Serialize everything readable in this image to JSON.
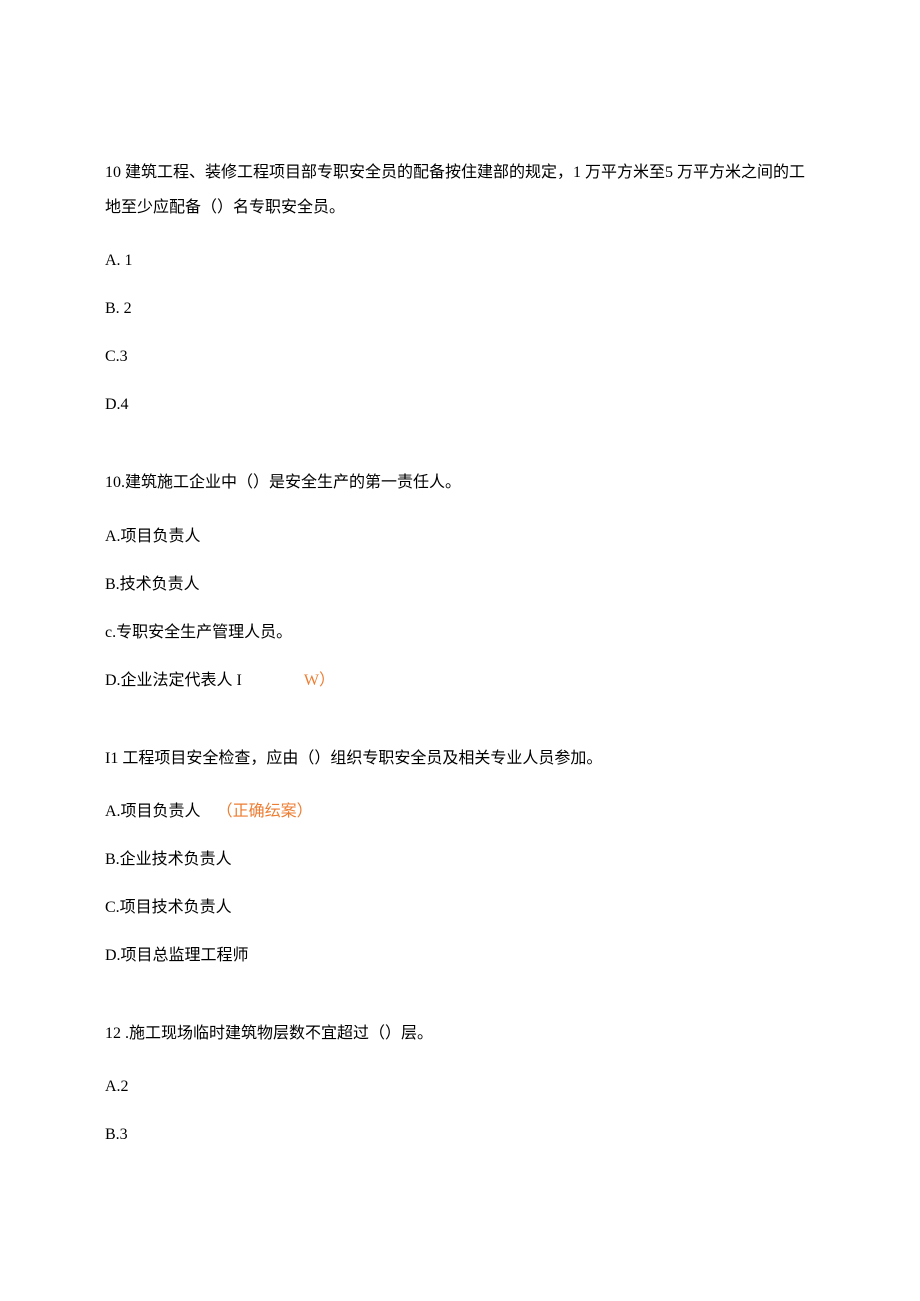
{
  "questions": [
    {
      "text": "10 建筑工程、装修工程项目部专职安全员的配备按住建部的规定，1 万平方米至5 万平方米之间的工地至少应配备（）名专职安全员。",
      "options": [
        {
          "label": "A.  1",
          "annotation": ""
        },
        {
          "label": "B.  2",
          "annotation": ""
        },
        {
          "label": "C.3",
          "annotation": ""
        },
        {
          "label": "D.4",
          "annotation": ""
        }
      ]
    },
    {
      "text": "10.建筑施工企业中（）是安全生产的第一责任人。",
      "options": [
        {
          "label": "A.项目负责人",
          "annotation": ""
        },
        {
          "label": "B.技术负责人",
          "annotation": ""
        },
        {
          "label": "c.专职安全生产管理人员。",
          "annotation": ""
        },
        {
          "label": "D.企业法定代表人 I",
          "annotation": "W）",
          "spaced": true
        }
      ]
    },
    {
      "text": "I1 工程项目安全检查，应由（）组织专职安全员及相关专业人员参加。",
      "options": [
        {
          "label": "A.项目负责人",
          "annotation": "（正确纭案）"
        },
        {
          "label": "B.企业技术负责人",
          "annotation": ""
        },
        {
          "label": "C.项目技术负责人",
          "annotation": ""
        },
        {
          "label": "D.项目总监理工程师",
          "annotation": ""
        }
      ]
    },
    {
      "text": "12  .施工现场临时建筑物层数不宜超过（）层。",
      "options": [
        {
          "label": "A.2",
          "annotation": ""
        },
        {
          "label": "B.3",
          "annotation": ""
        }
      ]
    }
  ]
}
